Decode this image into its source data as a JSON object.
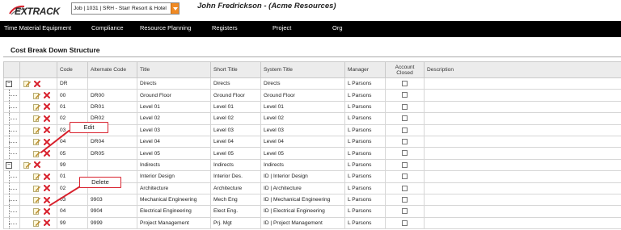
{
  "header": {
    "logo_text": "EXTRACK",
    "job_select_value": "Job | 1031 | SRH - Starr Resort & Hotel",
    "user_title": "John Fredrickson  -  (Acme Resources)"
  },
  "nav": {
    "items": [
      {
        "label": "Time Material Equipment"
      },
      {
        "label": "Compliance"
      },
      {
        "label": "Resource Planning"
      },
      {
        "label": "Registers"
      },
      {
        "label": "Project"
      },
      {
        "label": "Org"
      }
    ]
  },
  "page": {
    "title": "Cost Break Down Structure"
  },
  "table": {
    "headers": {
      "code": "Code",
      "alt_code": "Alternate Code",
      "title": "Title",
      "short_title": "Short Title",
      "system_title": "System Title",
      "manager": "Manager",
      "account_closed": "Account Closed",
      "description": "Description"
    },
    "rows": [
      {
        "level": "parent",
        "expander": "−",
        "code": "DR",
        "alt_code": "",
        "title": "Directs",
        "short_title": "Directs",
        "system_title": "Directs",
        "manager": "L Parsons"
      },
      {
        "level": "child",
        "code": "00",
        "alt_code": "DR00",
        "title": "Ground Floor",
        "short_title": "Ground Floor",
        "system_title": "Ground Floor",
        "manager": "L Parsons"
      },
      {
        "level": "child",
        "code": "01",
        "alt_code": "DR01",
        "title": "Level 01",
        "short_title": "Level 01",
        "system_title": "Level 01",
        "manager": "L Parsons"
      },
      {
        "level": "child",
        "code": "02",
        "alt_code": "DR02",
        "title": "Level 02",
        "short_title": "Level 02",
        "system_title": "Level 02",
        "manager": "L Parsons"
      },
      {
        "level": "child",
        "code": "03",
        "alt_code": "",
        "title": "Level 03",
        "short_title": "Level 03",
        "system_title": "Level 03",
        "manager": "L Parsons"
      },
      {
        "level": "child",
        "code": "04",
        "alt_code": "DR04",
        "title": "Level 04",
        "short_title": "Level 04",
        "system_title": "Level 04",
        "manager": "L Parsons"
      },
      {
        "level": "child",
        "code": "05",
        "alt_code": "DR05",
        "title": "Level 05",
        "short_title": "Level 05",
        "system_title": "Level 05",
        "manager": "L Parsons"
      },
      {
        "level": "parent",
        "expander": "−",
        "code": "99",
        "alt_code": "",
        "title": "Indirects",
        "short_title": "Indirects",
        "system_title": "Indirects",
        "manager": "L Parsons"
      },
      {
        "level": "child",
        "code": "01",
        "alt_code": "",
        "title": "Interior Design",
        "short_title": "Interior Des.",
        "system_title": "ID | Interior Design",
        "manager": "L Parsons"
      },
      {
        "level": "child",
        "code": "02",
        "alt_code": "",
        "title": "Architecture",
        "short_title": "Architecture",
        "system_title": "ID | Architecture",
        "manager": "L Parsons"
      },
      {
        "level": "child",
        "code": "03",
        "alt_code": "9903",
        "title": "Mechanical Engineering",
        "short_title": "Mech Eng",
        "system_title": "ID | Mechanical Engineering",
        "manager": "L Parsons"
      },
      {
        "level": "child",
        "code": "04",
        "alt_code": "9904",
        "title": "Electrical Engineering",
        "short_title": "Elect Eng.",
        "system_title": "ID | Electrical Engineering",
        "manager": "L Parsons"
      },
      {
        "level": "child",
        "code": "99",
        "alt_code": "9999",
        "title": "Project Management",
        "short_title": "Prj. Mgt",
        "system_title": "ID | Project Management",
        "manager": "L Parsons"
      }
    ]
  },
  "callouts": {
    "edit": "Edit",
    "delete": "Delete"
  },
  "colors": {
    "nav_bg": "#000000",
    "accent_orange": "#f08a24",
    "delete_red": "#d8212d",
    "callout_red": "#d8212d"
  }
}
